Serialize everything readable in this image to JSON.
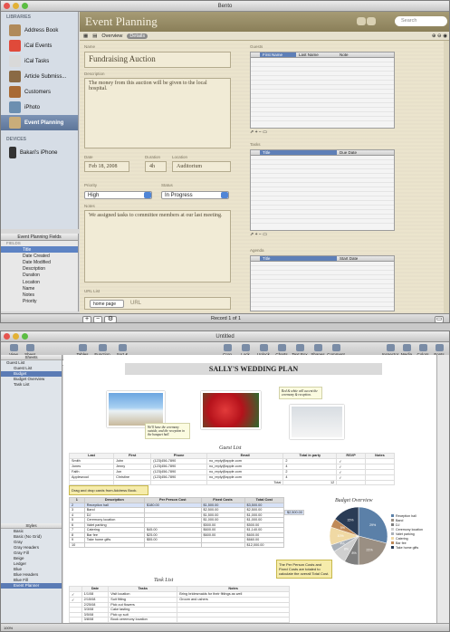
{
  "bento": {
    "window_title": "Bento",
    "sidebar": {
      "libraries_header": "LIBRARIES",
      "items": [
        {
          "label": "Address Book",
          "icon": "address-book-icon",
          "color": "#b08a5a"
        },
        {
          "label": "iCal Events",
          "icon": "calendar-icon",
          "color": "#e04a3a"
        },
        {
          "label": "iCal Tasks",
          "icon": "task-icon",
          "color": "#d9d9d9"
        },
        {
          "label": "Article Submiss...",
          "icon": "article-icon",
          "color": "#8a6a45"
        },
        {
          "label": "Customers",
          "icon": "customers-icon",
          "color": "#a86a34"
        },
        {
          "label": "iPhoto",
          "icon": "iphoto-icon",
          "color": "#6c8fb0"
        },
        {
          "label": "Event Planning",
          "icon": "event-planning-icon",
          "color": "#c9ad7a"
        }
      ],
      "devices_header": "DEVICES",
      "device": "Bakari's iPhone"
    },
    "fields": {
      "header": "Event Planning Fields",
      "group": "FIELDS",
      "items": [
        {
          "name": "Title",
          "type": ""
        },
        {
          "name": "Date Created",
          "type": ""
        },
        {
          "name": "Date Modified",
          "type": ""
        },
        {
          "name": "Description",
          "type": ""
        },
        {
          "name": "Duration",
          "type": ""
        },
        {
          "name": "Location",
          "type": ""
        },
        {
          "name": "Name",
          "type": ""
        },
        {
          "name": "Notes",
          "type": ""
        },
        {
          "name": "Priority",
          "type": ""
        }
      ]
    },
    "header": {
      "title": "Event Planning",
      "search_placeholder": "Search",
      "overview_tab": "Overview",
      "details_tab": "Details"
    },
    "form": {
      "name_label": "Name",
      "name_value": "Fundraising Auction",
      "description_label": "Description",
      "description_value": "The money from this auction will be given to the local hospital.",
      "date_label": "Date",
      "date_value": "Feb 18, 2008",
      "duration_label": "Duration",
      "duration_value": "4h",
      "location_label": "Location",
      "location_value": "Auditorium",
      "priority_label": "Priority",
      "priority_value": "High",
      "status_label": "Status",
      "status_value": "In Progress",
      "notes_label": "Notes",
      "notes_value": "We assigned tasks to committee members at our last meeting.",
      "url_label": "URL List",
      "url_select": "home page",
      "url_placeholder": "URL"
    },
    "guests": {
      "label": "Guests",
      "col1": "First Name",
      "col2": "Last Name",
      "col3": "Note"
    },
    "tasks": {
      "label": "Tasks",
      "col1": "Title",
      "col2": "Due Date"
    },
    "agenda": {
      "label": "Agenda",
      "col1": "Title",
      "col2": "Start Date"
    },
    "record_status": "Record 1 of 1"
  },
  "numbers": {
    "window_title": "Untitled",
    "toolbar": {
      "left": [
        {
          "label": "View"
        },
        {
          "label": "Sheet"
        }
      ],
      "mid": [
        {
          "label": "Tables"
        },
        {
          "label": "Function"
        },
        {
          "label": "Sort & Filter"
        }
      ],
      "right": [
        {
          "label": "Crop Style"
        },
        {
          "label": "Lock"
        },
        {
          "label": "Unlock"
        },
        {
          "label": "Charts"
        },
        {
          "label": "Text Box"
        },
        {
          "label": "Shapes"
        },
        {
          "label": "Comment"
        }
      ],
      "far": [
        {
          "label": "Inspector"
        },
        {
          "label": "Media"
        },
        {
          "label": "Colors"
        },
        {
          "label": "Fonts"
        }
      ]
    },
    "formula": "=AVERAGE(B3:B14)",
    "sheets_header": "Sheets",
    "sheets": [
      "Guest List",
      "Guest List",
      "Budget",
      "Budget Overview",
      "Task List"
    ],
    "styles_header": "Styles",
    "styles": [
      "Basic",
      "Basic (No Grid)",
      "Gray",
      "Gray Headers",
      "Gray Fill",
      "Beige",
      "Ledger",
      "Blue",
      "Blue Headers",
      "Blue Fill",
      "Event Planner"
    ],
    "plan_title": "SALLY'S WEDDING PLAN",
    "note1": "We'll have the ceremony outside, and the reception in the banquet hall.",
    "note2": "Red & white will accent the ceremony & reception.",
    "guest_title": "Guest List",
    "guest_cols": [
      "Last",
      "First",
      "Phone",
      "Email",
      "Total in party",
      "RSVP",
      "Notes"
    ],
    "guest_rows": [
      [
        "Smith",
        "John",
        "(123)456-7890",
        "no_reply@apple.com",
        "2",
        "✓",
        ""
      ],
      [
        "Jones",
        "Jenny",
        "(123)456-7890",
        "no_reply@apple.com",
        "4",
        "✓",
        ""
      ],
      [
        "Faith",
        "Jon",
        "(123)456-7890",
        "no_reply@apple.com",
        "2",
        "✓",
        ""
      ],
      [
        "Applewood",
        "Christine",
        "(123)456-7890",
        "no_reply@apple.com",
        "4",
        "✓",
        ""
      ]
    ],
    "guest_total_label": "Total",
    "guest_total": "12",
    "drag_note": "Drag and drop cards from Address Book.",
    "budget_cols": [
      "A",
      "Description",
      "Per Person Cost",
      "Fixed Costs",
      "Total Cost",
      "",
      "F"
    ],
    "budget_rows": [
      [
        "1",
        "Description",
        "Per Person Cost",
        "Fixed Costs",
        "Total Cost"
      ],
      [
        "2",
        "Reception hall",
        "$180.00",
        "$1,500.00",
        "$3,500.00"
      ],
      [
        "3",
        "Band",
        "",
        "$2,500.00",
        "$2,500.00"
      ],
      [
        "4",
        "DJ",
        "",
        "$1,500.00",
        "$1,000.00"
      ],
      [
        "5",
        "Ceremony location",
        "",
        "$1,000.00",
        "$1,000.00"
      ],
      [
        "6",
        "Valet parking",
        "",
        "$500.00",
        "$500.00"
      ],
      [
        "7",
        "Catering",
        "$45.00",
        "$600.00",
        "$1,140.00"
      ],
      [
        "8",
        "Bar fee",
        "$25.00",
        "$600.00",
        "$600.00"
      ],
      [
        "9",
        "Take home gifts",
        "$55.00",
        "",
        "$660.00"
      ],
      [
        "10",
        "",
        "",
        "",
        "$12,000.00"
      ]
    ],
    "budget_extra": "$2,500.00",
    "cost_note": "The Per Person Costs and Fixed Costs are totaled to calculate the overall Total Cost.",
    "budget_overview_title": "Budget Overview",
    "chart_data": {
      "type": "pie",
      "title": "Budget Overview",
      "categories": [
        "Reception hall",
        "Band",
        "DJ",
        "Ceremony location",
        "Valet parking",
        "Catering",
        "Bar fee",
        "Take home gifts"
      ],
      "values": [
        29,
        21,
        8,
        8,
        4,
        10,
        5,
        15
      ],
      "labels": [
        "29%",
        "21%",
        "8%",
        "8%",
        "4%",
        "10%",
        "5%",
        "15%"
      ],
      "colors": [
        "#5b80a8",
        "#9a8f83",
        "#7f7f7f",
        "#cfcfcf",
        "#a9b0b8",
        "#f0d9a4",
        "#c08a58",
        "#2a3c56"
      ],
      "legend": "right"
    },
    "task_title": "Task List",
    "task_cols": [
      "",
      "Date",
      "Tasks",
      "Notes"
    ],
    "task_rows": [
      [
        "✓",
        "1/1/08",
        "Visit location",
        "Bring bridesmaids for their fittings as well"
      ],
      [
        "✓",
        "2/15/08",
        "Suit fitting",
        "Groom and ushers"
      ],
      [
        "",
        "2/25/08",
        "Pick out flowers",
        ""
      ],
      [
        "",
        "3/3/08",
        "Cake tasting",
        ""
      ],
      [
        "",
        "3/5/08",
        "Pick up suit",
        ""
      ],
      [
        "",
        "3/8/08",
        "Book ceremony location",
        ""
      ]
    ],
    "zoom": "100%"
  }
}
